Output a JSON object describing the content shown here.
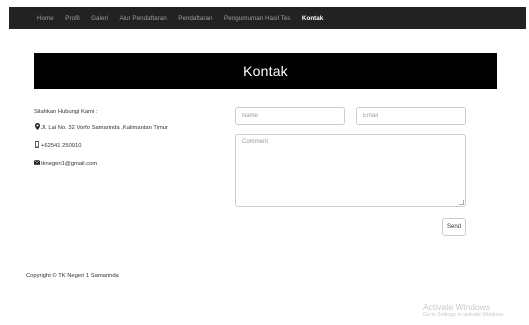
{
  "nav": {
    "items": [
      {
        "label": "Home",
        "active": false
      },
      {
        "label": "Profil",
        "active": false
      },
      {
        "label": "Galeri",
        "active": false
      },
      {
        "label": "Alur Pendaftaran",
        "active": false
      },
      {
        "label": "Pendaftaran",
        "active": false
      },
      {
        "label": "Pengumuman Hasil Tes",
        "active": false
      },
      {
        "label": "Kontak",
        "active": true
      }
    ]
  },
  "banner": {
    "title": "Kontak"
  },
  "contact": {
    "heading": "Silahkan Hubungi Kami :",
    "address": "Jl. Lai No. 32 Vorfo Samarinda ,Kalimantan Timur",
    "phone": "+62541 250910",
    "email": "tknegeri1@gmail.com",
    "icons": {
      "address": "map-marker-icon",
      "phone": "mobile-phone-icon",
      "email": "envelope-icon"
    }
  },
  "form": {
    "name_placeholder": "Name",
    "email_placeholder": "Email",
    "comment_placeholder": "Comment",
    "send_label": "Send"
  },
  "footer": {
    "copyright": "Copyright © TK Negeri 1 Samarinda"
  },
  "watermark": {
    "title": "Activate Windows",
    "subtitle": "Go to Settings to activate Windows."
  },
  "colors": {
    "navbar_bg": "#222222",
    "nav_text": "#9d9d9d",
    "nav_active": "#ffffff",
    "banner_bg": "#000000",
    "banner_text": "#ffffff",
    "border": "#cccccc"
  }
}
